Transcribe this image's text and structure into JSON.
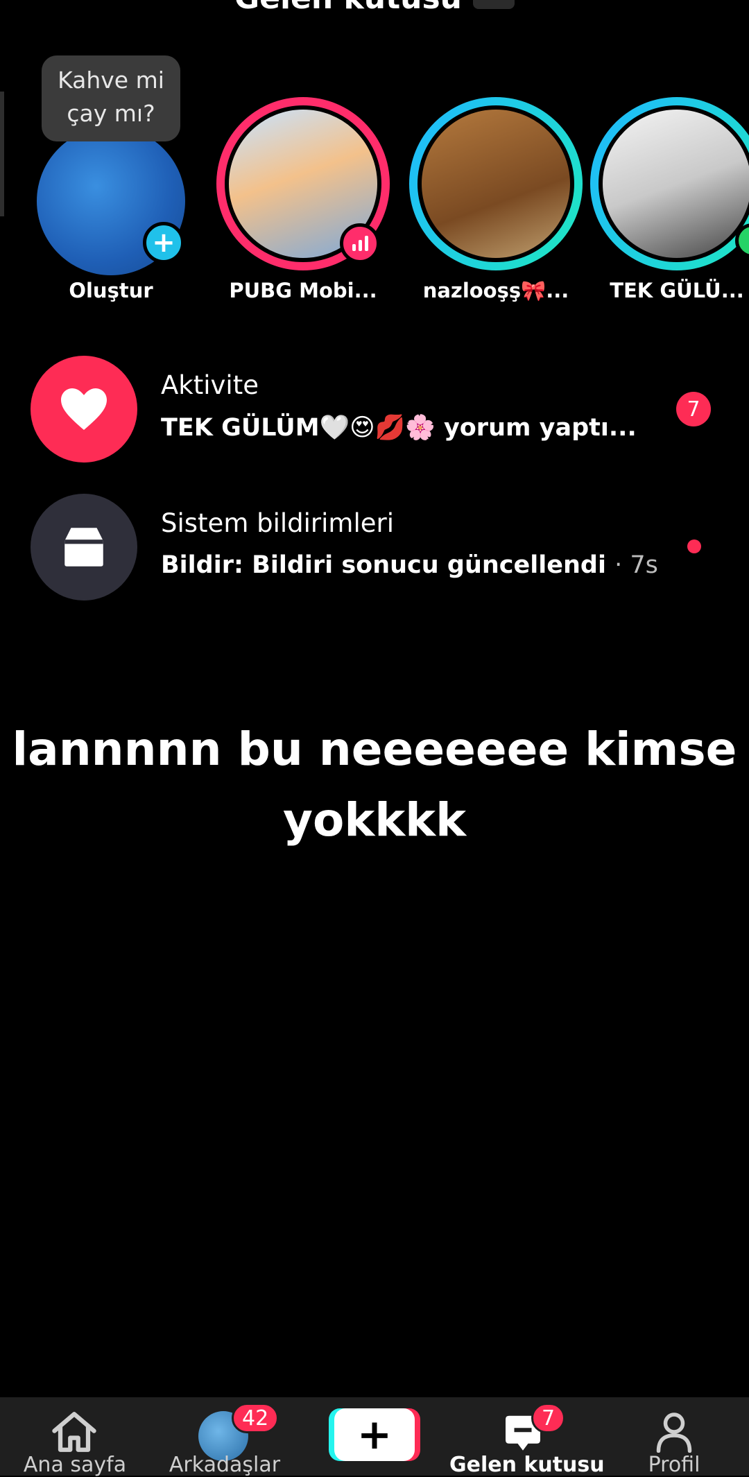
{
  "header": {
    "title": "Gelen kutusu"
  },
  "tooltip": {
    "text_line1": "Kahve mi",
    "text_line2": "çay mı?"
  },
  "stories": [
    {
      "label": "Oluştur"
    },
    {
      "label": "PUBG Mobi..."
    },
    {
      "label": "nazlooşş🎀..."
    },
    {
      "label": "TEK GÜLÜ..."
    }
  ],
  "activity": {
    "title": "Aktivite",
    "subtitle": "TEK GÜLÜM🤍😍💋🌸 yorum yaptı...",
    "badge": "7"
  },
  "system": {
    "title": "Sistem bildirimleri",
    "subtitle": "Bildir: Bildiri sonucu güncellendi",
    "time": "· 7s"
  },
  "caption": {
    "line1": "lannnnn bu neeeeeee kimse",
    "line2": "yokkkk"
  },
  "nav": {
    "home": "Ana sayfa",
    "friends": "Arkadaşlar",
    "friends_badge": "42",
    "inbox": "Gelen kutusu",
    "inbox_badge": "7",
    "profile": "Profil",
    "create_symbol": "+"
  },
  "colors": {
    "accent": "#fe2c55",
    "cyan": "#20c1ea",
    "activity_icon_bg": "#fe2c55",
    "system_icon_bg": "#2f2f3a"
  },
  "icons": [
    "heart-icon",
    "inbox-tray-icon",
    "home-icon",
    "inbox-icon",
    "profile-icon",
    "plus-icon",
    "live-bars-icon"
  ]
}
